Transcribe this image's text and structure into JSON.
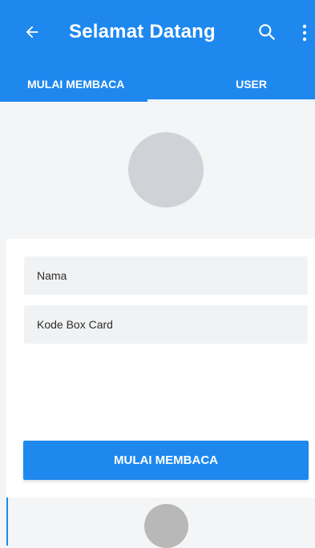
{
  "app_bar": {
    "title": "Selamat Datang",
    "back_icon": "arrow-left-icon",
    "search_icon": "search-icon",
    "more_icon": "more-vert-icon",
    "color": "#1e88ef"
  },
  "tabs": [
    {
      "label": "MULAI MEMBACA",
      "active": false
    },
    {
      "label": "USER",
      "active": true
    }
  ],
  "form": {
    "name_placeholder": "Nama",
    "code_placeholder": "Kode Box Card"
  },
  "primary_button": {
    "label": "MULAI MEMBACA"
  }
}
